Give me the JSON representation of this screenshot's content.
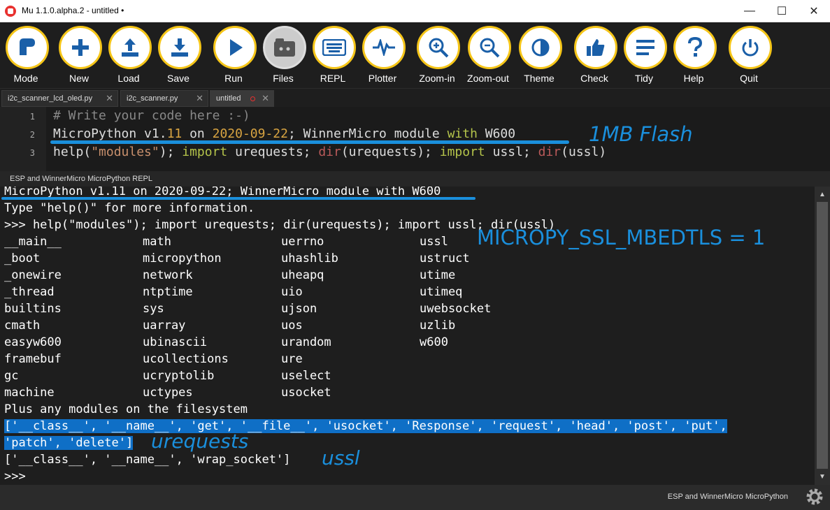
{
  "window": {
    "title": "Mu 1.1.0.alpha.2 - untitled •",
    "minimize": "—",
    "maximize": "☐",
    "close": "✕"
  },
  "toolbar": {
    "buttons": [
      {
        "label": "Mode",
        "icon": "mode-icon"
      },
      {
        "label": "New",
        "icon": "plus-icon"
      },
      {
        "label": "Load",
        "icon": "upload-icon"
      },
      {
        "label": "Save",
        "icon": "download-icon"
      },
      {
        "label": "Run",
        "icon": "play-icon"
      },
      {
        "label": "Files",
        "icon": "files-icon"
      },
      {
        "label": "REPL",
        "icon": "keyboard-icon"
      },
      {
        "label": "Plotter",
        "icon": "waveform-icon"
      },
      {
        "label": "Zoom-in",
        "icon": "zoom-in-icon"
      },
      {
        "label": "Zoom-out",
        "icon": "zoom-out-icon"
      },
      {
        "label": "Theme",
        "icon": "theme-icon"
      },
      {
        "label": "Check",
        "icon": "thumbs-up-icon"
      },
      {
        "label": "Tidy",
        "icon": "lines-icon"
      },
      {
        "label": "Help",
        "icon": "question-icon"
      },
      {
        "label": "Quit",
        "icon": "power-icon"
      }
    ]
  },
  "tabs": [
    {
      "label": "i2c_scanner_lcd_oled.py"
    },
    {
      "label": "i2c_scanner.py"
    },
    {
      "label": "untitled"
    }
  ],
  "editor": {
    "line_numbers": [
      "1",
      "2",
      "3"
    ],
    "line1": "# Write your code here :-)",
    "line2": {
      "a": "MicroPython v1.",
      "b": "11",
      "c": " on ",
      "d": "2020-09-22",
      "e": "; WinnerMicro module ",
      "f": "with",
      "g": " W600"
    },
    "line3": {
      "a": "help(",
      "b": "\"modules\"",
      "c": "); ",
      "d": "import",
      "e": " urequests; ",
      "f": "dir",
      "g": "(urequests); ",
      "h": "import",
      "i": " ussl; ",
      "j": "dir",
      "k": "(ussl)"
    }
  },
  "annotations": {
    "flash": "1MB Flash",
    "mbedtls": "MICROPY_SSL_MBEDTLS = 1",
    "urequests": "urequests",
    "ussl": "ussl"
  },
  "repl": {
    "header": "ESP and WinnerMicro MicroPython REPL",
    "banner": "MicroPython v1.11 on 2020-09-22; WinnerMicro module with W600",
    "help_hint": "Type \"help()\" for more information.",
    "command": ">>> help(\"modules\"); import urequests; dir(urequests); import ussl; dir(ussl)",
    "modules": [
      [
        "__main__",
        "math",
        "uerrno",
        "ussl"
      ],
      [
        "_boot",
        "micropython",
        "uhashlib",
        "ustruct"
      ],
      [
        "_onewire",
        "network",
        "uheapq",
        "utime"
      ],
      [
        "_thread",
        "ntptime",
        "uio",
        "utimeq"
      ],
      [
        "builtins",
        "sys",
        "ujson",
        "uwebsocket"
      ],
      [
        "cmath",
        "uarray",
        "uos",
        "uzlib"
      ],
      [
        "easyw600",
        "ubinascii",
        "urandom",
        "w600"
      ],
      [
        "framebuf",
        "ucollections",
        "ure",
        ""
      ],
      [
        "gc",
        "ucryptolib",
        "uselect",
        ""
      ],
      [
        "machine",
        "uctypes",
        "usocket",
        ""
      ]
    ],
    "plus": "Plus any modules on the filesystem",
    "urequests_dir_1": "['__class__', '__name__', 'get', '__file__', 'usocket', 'Response', 'request', 'head', 'post', 'put',",
    "urequests_dir_2": "'patch', 'delete']",
    "ussl_dir": "['__class__', '__name__', 'wrap_socket']",
    "prompt": ">>>"
  },
  "status": {
    "mode": "ESP and WinnerMicro MicroPython"
  },
  "colors": {
    "accent": "#f5c518",
    "annotation": "#1a8fdc",
    "selection": "#0f6fc6"
  }
}
